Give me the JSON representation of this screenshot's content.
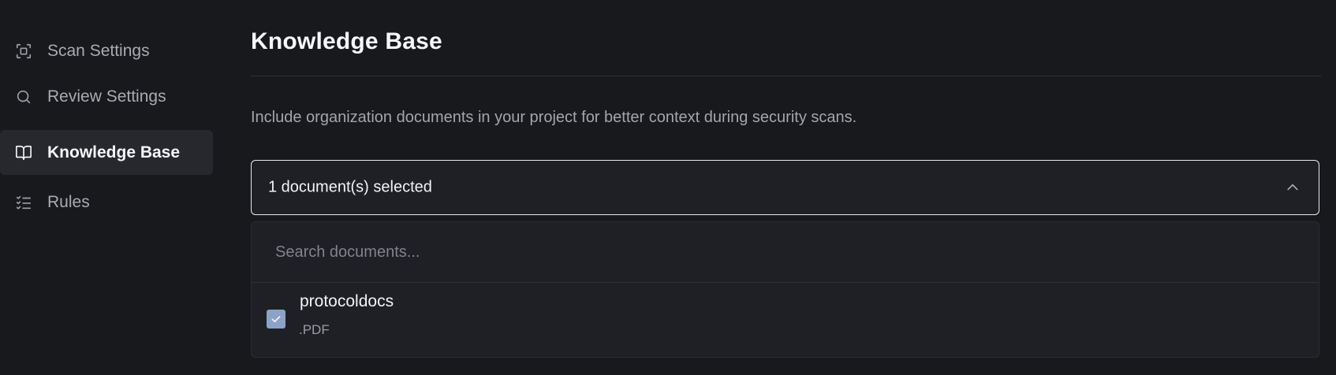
{
  "sidebar": {
    "items": [
      {
        "label": "Scan Settings",
        "icon": "scan-icon",
        "active": false
      },
      {
        "label": "Review Settings",
        "icon": "search-icon",
        "active": false
      },
      {
        "label": "Knowledge Base",
        "icon": "book-open-icon",
        "active": true
      },
      {
        "label": "Rules",
        "icon": "checklist-icon",
        "active": false
      }
    ]
  },
  "main": {
    "title": "Knowledge Base",
    "description": "Include organization documents in your project for better context during security scans.",
    "select": {
      "value": "1 document(s) selected",
      "expanded": true
    },
    "dropdown": {
      "search_placeholder": "Search documents...",
      "items": [
        {
          "name": "protocoldocs",
          "type": ".PDF",
          "checked": true
        }
      ]
    }
  },
  "colors": {
    "background": "#18191d",
    "active_nav": "#27282d",
    "checkbox": "#8da2c7"
  }
}
